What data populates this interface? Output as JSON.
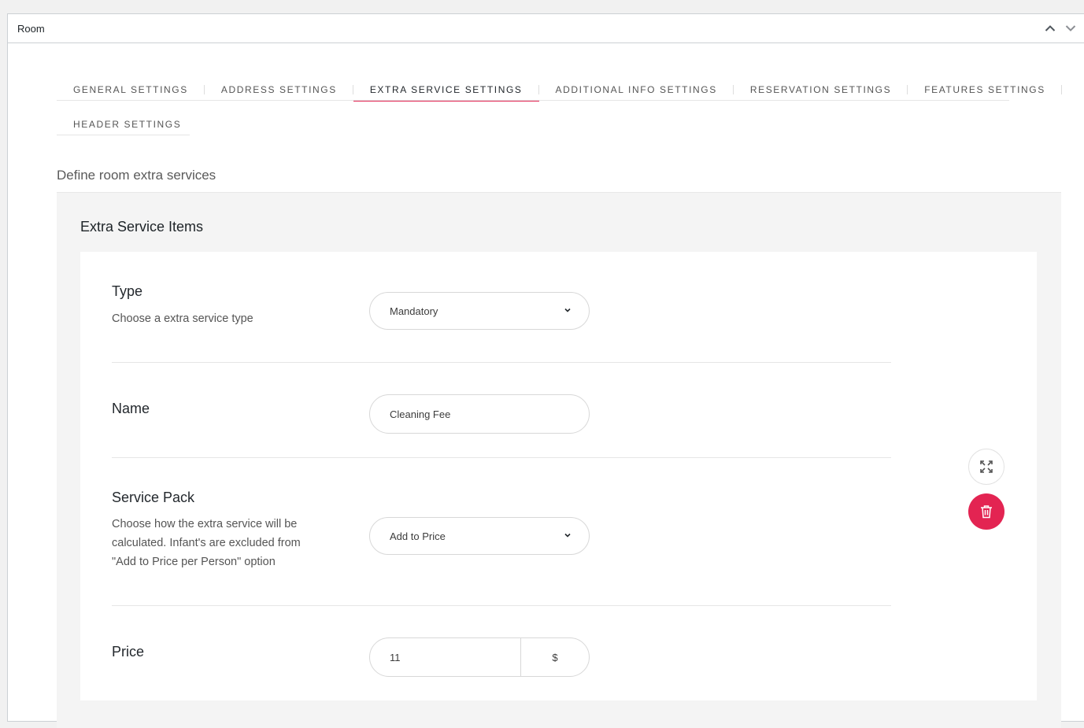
{
  "metabox": {
    "title": "Room",
    "icons": {
      "collapse": "chevron-up-icon",
      "move": "chevron-down-icon"
    }
  },
  "tabs": [
    {
      "label": "GENERAL SETTINGS",
      "active": false
    },
    {
      "label": "ADDRESS SETTINGS",
      "active": false
    },
    {
      "label": "EXTRA SERVICE SETTINGS",
      "active": true
    },
    {
      "label": "ADDITIONAL INFO SETTINGS",
      "active": false
    },
    {
      "label": "RESERVATION SETTINGS",
      "active": false
    },
    {
      "label": "FEATURES SETTINGS",
      "active": false
    },
    {
      "label": "HEADER SETTINGS",
      "active": false
    }
  ],
  "section": {
    "title": "Define room extra services",
    "repeater_title": "Extra Service Items"
  },
  "fields": {
    "type": {
      "label": "Type",
      "description": "Choose a extra service type",
      "value": "Mandatory"
    },
    "name": {
      "label": "Name",
      "value": "Cleaning Fee"
    },
    "service_pack": {
      "label": "Service Pack",
      "description": "Choose how the extra service will be calculated. Infant's are excluded from \"Add to Price per Person\" option",
      "value": "Add to Price"
    },
    "price": {
      "label": "Price",
      "value": "11",
      "currency": "$"
    }
  },
  "actions": {
    "expand_icon": "expand-icon",
    "delete_icon": "trash-icon"
  },
  "colors": {
    "accent": "#e32452",
    "panel_bg": "#f4f4f4",
    "border": "#d8d8d8"
  }
}
